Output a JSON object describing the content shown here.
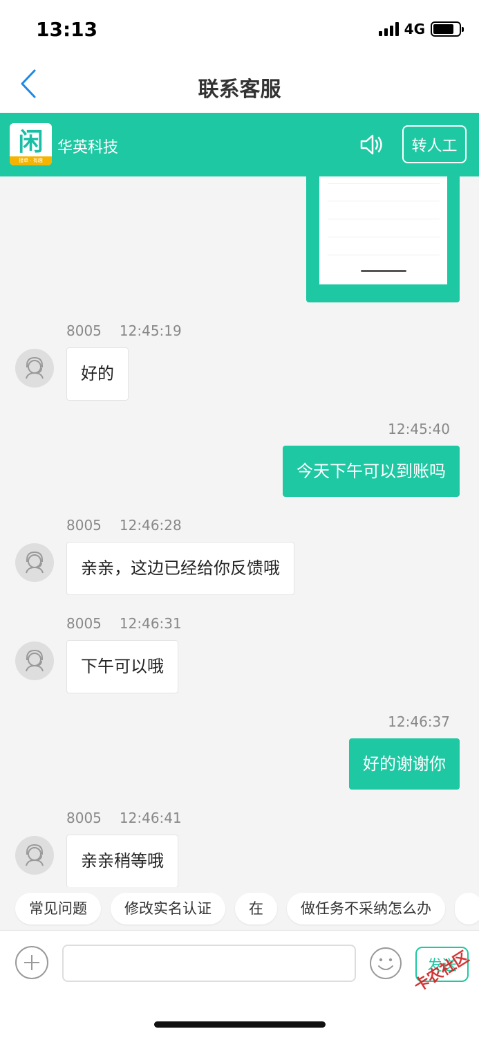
{
  "status_bar": {
    "time": "13:13",
    "network": "4G"
  },
  "nav": {
    "title": "联系客服"
  },
  "banner": {
    "company": "华英科技",
    "transfer_label": "转人工",
    "logo_char": "闲",
    "logo_caption": "接单 · 有趣"
  },
  "messages": [
    {
      "side": "left",
      "sender": "8005",
      "time": "12:45:19",
      "text": "好的"
    },
    {
      "side": "right",
      "time": "12:45:40",
      "text": "今天下午可以到账吗"
    },
    {
      "side": "left",
      "sender": "8005",
      "time": "12:46:28",
      "text": "亲亲，这边已经给你反馈哦"
    },
    {
      "side": "left",
      "sender": "8005",
      "time": "12:46:31",
      "text": "下午可以哦"
    },
    {
      "side": "right",
      "time": "12:46:37",
      "text": "好的谢谢你"
    },
    {
      "side": "left",
      "sender": "8005",
      "time": "12:46:41",
      "text": "亲亲稍等哦"
    }
  ],
  "quick_replies": [
    "常见问题",
    "修改实名认证",
    "在",
    "做任务不采纳怎么办"
  ],
  "input": {
    "value": "",
    "placeholder": ""
  },
  "send_label": "发送",
  "watermark": "卡农社区",
  "colors": {
    "accent": "#1ec8a3"
  }
}
